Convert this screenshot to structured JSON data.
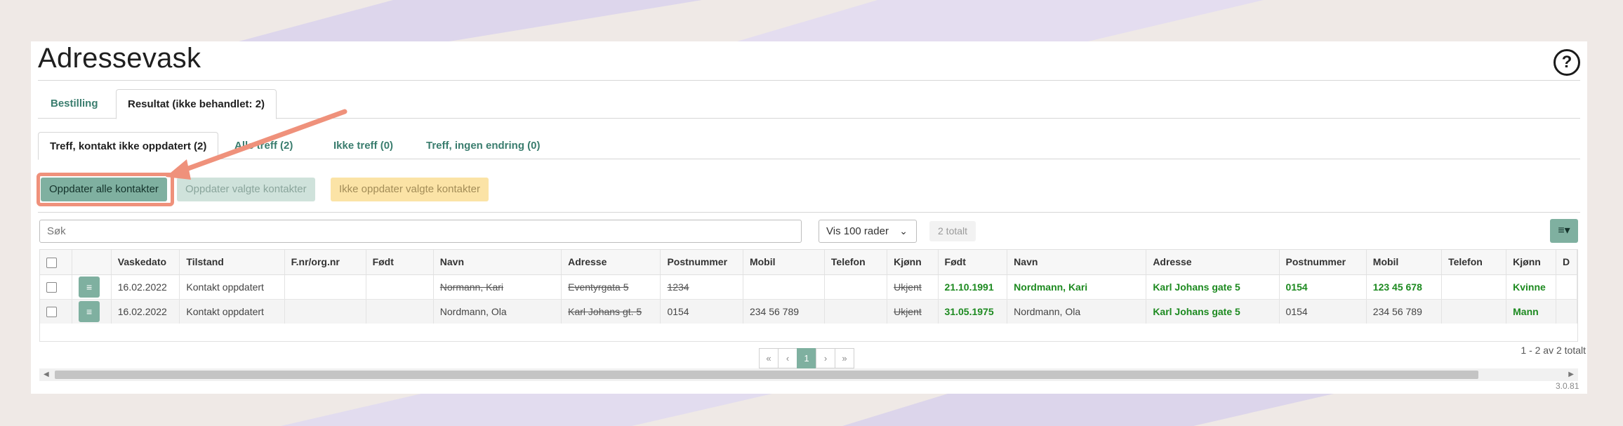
{
  "title": "Adressevask",
  "help_icon_label": "?",
  "main_tabs": [
    {
      "label": "Bestilling",
      "active": false
    },
    {
      "label": "Resultat (ikke behandlet: 2)",
      "active": true
    }
  ],
  "sub_tabs": [
    {
      "label": "Treff, kontakt ikke oppdatert (2)",
      "active": true
    },
    {
      "label": "Alle treff (2)",
      "active": false
    },
    {
      "label": "Ikke treff (0)",
      "active": false
    },
    {
      "label": "Treff, ingen endring (0)",
      "active": false
    }
  ],
  "actions": {
    "update_all": "Oppdater alle kontakter",
    "update_selected": "Oppdater valgte kontakter",
    "skip_selected": "Ikke oppdater valgte kontakter"
  },
  "search": {
    "placeholder": "Søk"
  },
  "rows_select": {
    "value": "Vis 100 rader"
  },
  "total_badge": "2 totalt",
  "columns_button_icon": "list-dropdown-icon",
  "table": {
    "headers": [
      "",
      "",
      "Vaskedato",
      "Tilstand",
      "F.nr/org.nr",
      "Født",
      "Navn",
      "Adresse",
      "Postnummer",
      "Mobil",
      "Telefon",
      "Kjønn",
      "Født",
      "Navn",
      "Adresse",
      "Postnummer",
      "Mobil",
      "Telefon",
      "Kjønn",
      "D"
    ],
    "rows": [
      {
        "vaskedato": "16.02.2022",
        "tilstand": "Kontakt oppdatert",
        "fnr": "",
        "fodt_old": "",
        "navn_old": "Normann, Kari",
        "adresse_old": "Eventyrgata 5",
        "postnr_old": "1234",
        "mobil_old": "",
        "telefon_old": "",
        "kjonn_old": "Ukjent",
        "fodt_new": "21.10.1991",
        "navn_new": "Nordmann, Kari",
        "adresse_new": "Karl Johans gate 5",
        "postnr_new": "0154",
        "mobil_new": "123 45 678",
        "telefon_new": "",
        "kjonn_new": "Kvinne"
      },
      {
        "vaskedato": "16.02.2022",
        "tilstand": "Kontakt oppdatert",
        "fnr": "",
        "fodt_old": "",
        "navn_old": "Nordmann, Ola",
        "adresse_old": "Karl Johans gt. 5",
        "postnr_old": "0154",
        "mobil_old": "234 56 789",
        "telefon_old": "",
        "kjonn_old": "Ukjent",
        "fodt_new": "31.05.1975",
        "navn_new": "Nordmann, Ola",
        "adresse_new": "Karl Johans gate 5",
        "postnr_new": "0154",
        "mobil_new": "234 56 789",
        "telefon_new": "",
        "kjonn_new": "Mann"
      }
    ]
  },
  "pagination": {
    "first": "«",
    "prev": "‹",
    "current": "1",
    "next": "›",
    "last": "»"
  },
  "range_text": "1 - 2 av 2 totalt",
  "version": "3.0.81",
  "colors": {
    "accent": "#7fb0a0",
    "highlight": "#ef917b",
    "changed_text": "#1d8a20",
    "tab_link": "#3a7d6e"
  }
}
